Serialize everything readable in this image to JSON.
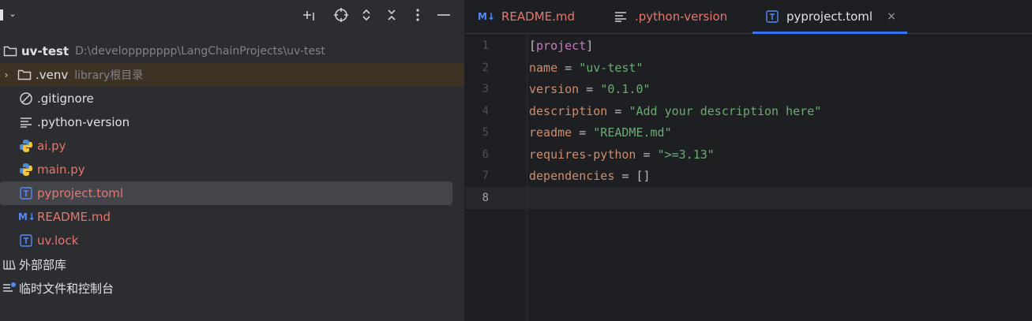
{
  "project_panel": {
    "root": {
      "name": "uv-test",
      "path": "D:\\developpppppp\\LangChainProjects\\uv-test"
    },
    "items": [
      {
        "name": ".venv",
        "hint": "library根目录"
      },
      {
        "name": ".gitignore"
      },
      {
        "name": ".python-version"
      },
      {
        "name": "ai.py"
      },
      {
        "name": "main.py"
      },
      {
        "name": "pyproject.toml"
      },
      {
        "name": "README.md"
      },
      {
        "name": "uv.lock"
      }
    ],
    "external_libraries": "外部部库",
    "scratches": "临时文件和控制台",
    "readme_badge": "M↓"
  },
  "editor": {
    "tabs": [
      {
        "label": "README.md",
        "badge": "M↓"
      },
      {
        "label": ".python-version"
      },
      {
        "label": "pyproject.toml",
        "close": "×"
      }
    ],
    "line_numbers": [
      "1",
      "2",
      "3",
      "4",
      "5",
      "6",
      "7",
      "8"
    ],
    "code": {
      "l1": "project",
      "l2_key": "name",
      "l2_val": "\"uv-test\"",
      "l3_key": "version",
      "l3_val": "\"0.1.0\"",
      "l4_key": "description",
      "l4_val": "\"Add your description here\"",
      "l5_key": "readme",
      "l5_val": "\"README.md\"",
      "l6_key": "requires-python",
      "l6_val": "\">=3.13\"",
      "l7_key": "dependencies",
      "l7_val": "[]"
    },
    "colors": {
      "accent": "#3574f0",
      "string": "#6aab73",
      "key": "#cf8e6d",
      "modified": "#e5786d"
    }
  }
}
